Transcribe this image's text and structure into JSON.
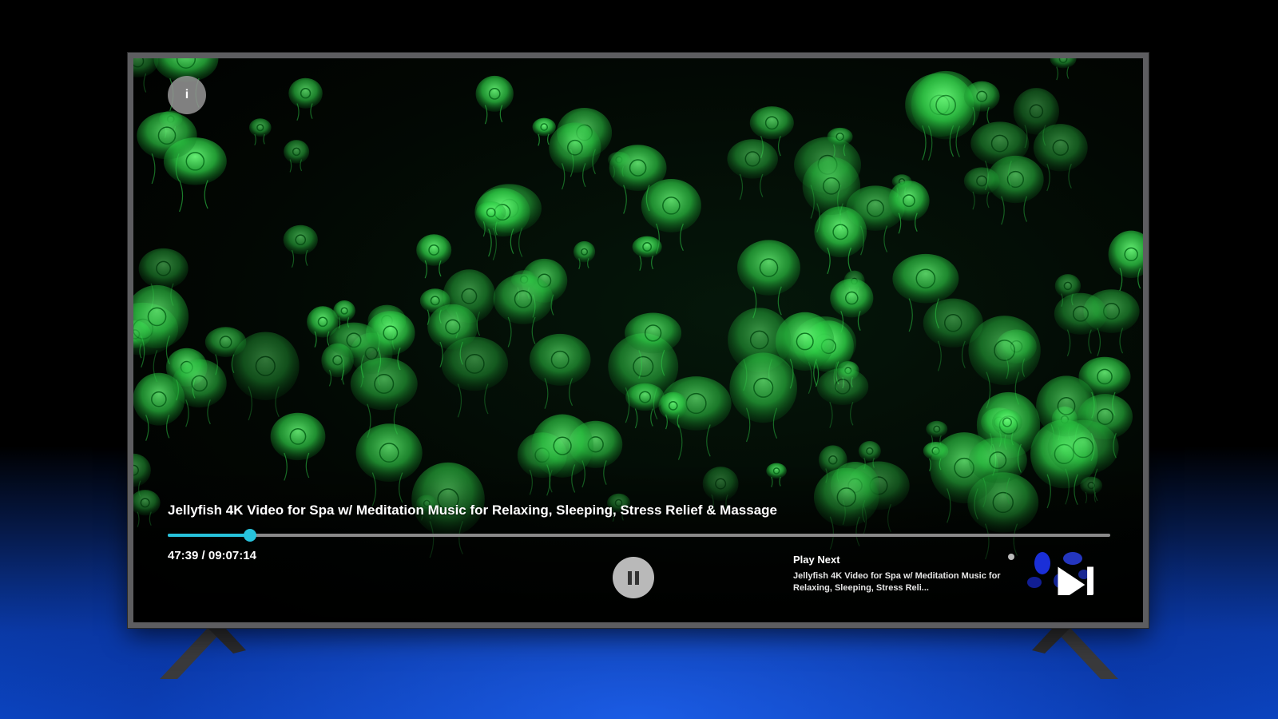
{
  "player": {
    "info_button_glyph": "i",
    "title": "Jellyfish 4K Video for Spa w/ Meditation Music for Relaxing, Sleeping, Stress Relief & Massage",
    "time_readout": "47:39 / 09:07:14",
    "progress_fraction": 0.087,
    "accent_color": "#27c3dc"
  },
  "controls": {
    "pause_icon": "pause-icon"
  },
  "play_next": {
    "label": "Play Next",
    "title": "Jellyfish 4K Video for Spa w/ Meditation Music for Relaxing, Sleeping, Stress Reli...",
    "skip_icon": "skip-next-icon"
  },
  "colors": {
    "jellyfish_glow": "#36e04e",
    "background_blue": "#0b46c4",
    "tv_bezel": "#5d5d60"
  }
}
